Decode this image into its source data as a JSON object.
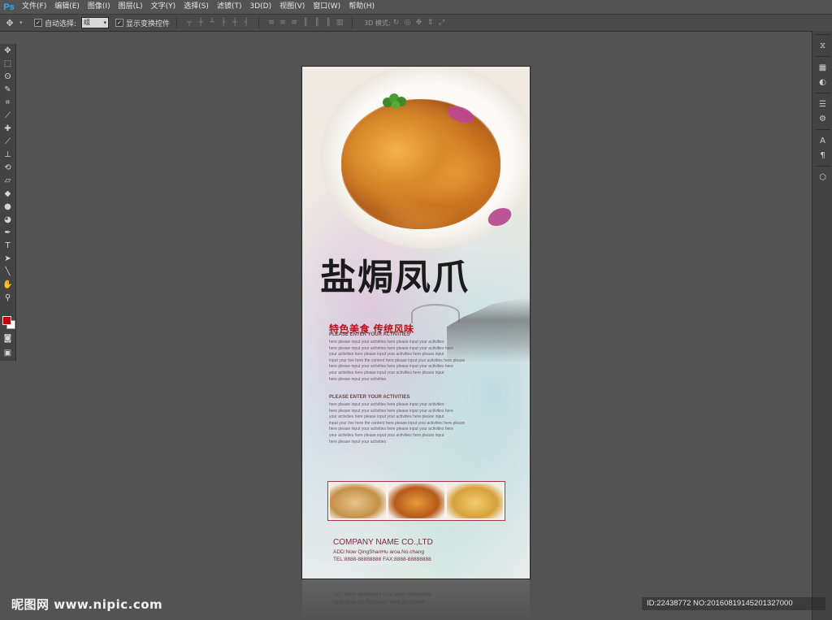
{
  "app": {
    "logo": "Ps",
    "menu": [
      "文件(F)",
      "编辑(E)",
      "图像(I)",
      "图层(L)",
      "文字(Y)",
      "选择(S)",
      "滤镜(T)",
      "3D(D)",
      "视图(V)",
      "窗口(W)",
      "帮助(H)"
    ]
  },
  "options": {
    "auto_select_label": "自动选择:",
    "auto_select_value": "组",
    "show_transform_label": "显示变换控件",
    "mode_3d_label": "3D 模式:"
  },
  "colors": {
    "foreground": "#c00000",
    "background": "#ffffff",
    "title_red": "#b3141b"
  },
  "poster": {
    "title": "盐焗凤爪",
    "subtitle": "特色美食 传统风味",
    "section1_heading": "PLEASE ENTER YOUR ACTIVITIES",
    "section1_lines": [
      "here please input your activities here please input your activities",
      "here please input your activities here please input your activities here",
      "your activities here please input your activities here please input",
      "input your live here the content here please input your activities here please",
      "here please input your activities here please input your activities here",
      "your activities here please input your activities here please input",
      "here please input your activities"
    ],
    "section2_heading": "PLEASE ENTER YOUR ACTIVITIES",
    "section2_lines": [
      "here please input your activities here please input your activities",
      "here please input your activities here please input your activities here",
      "your activities here please input your activities here please input",
      "input your live here the content here please input your activities here please",
      "here please input your activities here please input your activities here",
      "your activities here please input your activities here please input",
      "here please input your activities"
    ],
    "company": "COMPANY NAME CO.,LTD",
    "address": "ADD:Now QingShanHu aroa.No.chang",
    "tel_fax": "TEL:8888-88888888    FAX:8888-88888888"
  },
  "watermark": {
    "left": "昵图网 www.nipic.com",
    "right": "ID:22438772 NO:20160819145201327000"
  }
}
